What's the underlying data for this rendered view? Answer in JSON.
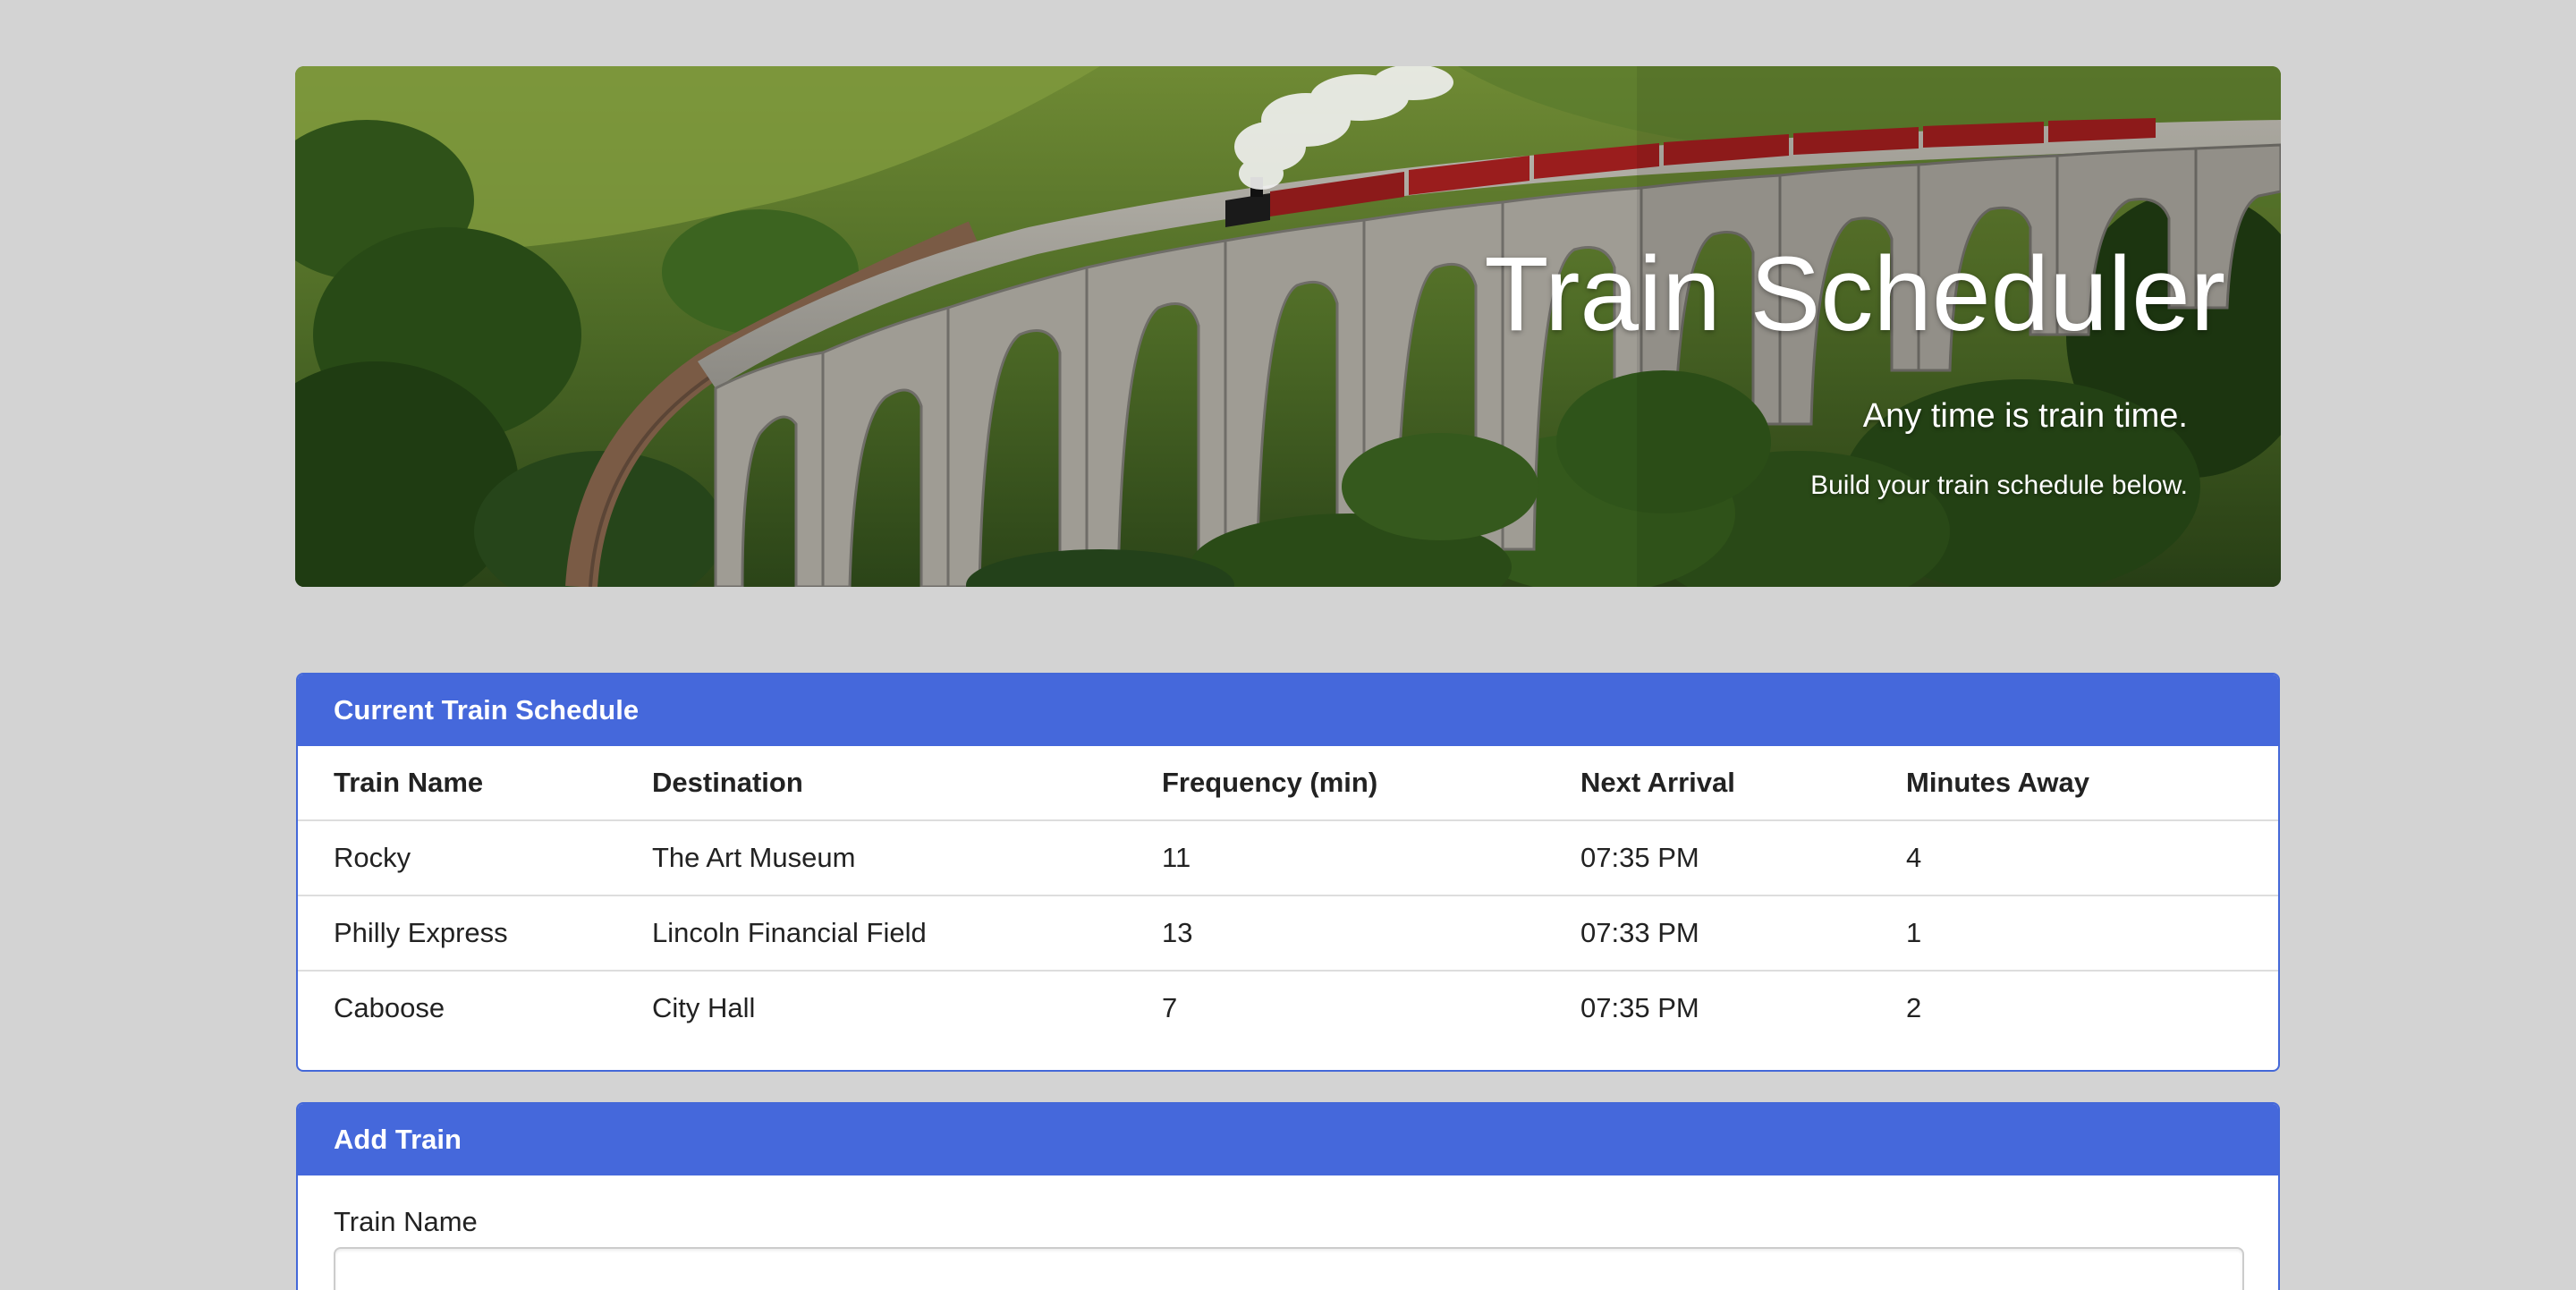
{
  "hero": {
    "title": "Train Scheduler",
    "tagline": "Any time is train time.",
    "subtitle": "Build your train schedule below."
  },
  "schedule": {
    "heading": "Current Train Schedule",
    "columns": [
      "Train Name",
      "Destination",
      "Frequency (min)",
      "Next Arrival",
      "Minutes Away"
    ],
    "rows": [
      [
        "Rocky",
        "The Art Museum",
        "11",
        "07:35 PM",
        "4"
      ],
      [
        "Philly Express",
        "Lincoln Financial Field",
        "13",
        "07:33 PM",
        "1"
      ],
      [
        "Caboose",
        "City Hall",
        "7",
        "07:35 PM",
        "2"
      ]
    ]
  },
  "add_train": {
    "heading": "Add Train",
    "train_name_label": "Train Name",
    "train_name_value": ""
  },
  "colors": {
    "page_background": "#d3d3d3",
    "panel_heading": "#4568db",
    "panel_heading_text": "#ffffff"
  }
}
